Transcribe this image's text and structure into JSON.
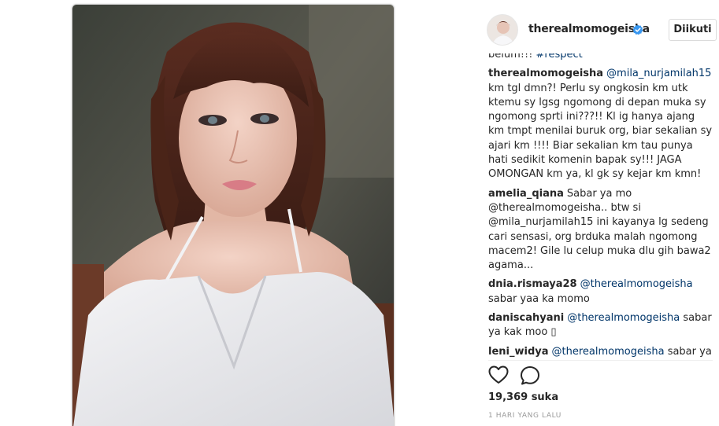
{
  "post": {
    "username": "therealmomogeisha",
    "follow_label": "Diikuti",
    "likes": "19,369 suka",
    "timestamp": "1 HARI YANG LALU"
  },
  "comments": [
    {
      "user": "",
      "mention": "",
      "text": "belum!!! ",
      "tag": "#respect"
    },
    {
      "user": "therealmomogeisha",
      "mention": "@mila_nurjamilah15",
      "text": " km tgl dmn?! Perlu sy ongkosin km utk ktemu sy lgsg ngomong di depan muka sy ngomong sprti ini???!! Kl ig hanya ajang km tmpt menilai buruk org, biar sekalian sy ajari km !!!! Biar sekalian km tau punya hati sedikit komenin bapak sy!!! JAGA OMONGAN km ya, kl gk sy kejar km kmn!",
      "tag": ""
    },
    {
      "user": "amelia_qiana",
      "mention": "",
      "text": "Sabar ya mo @therealmomogeisha.. btw si @mila_nurjamilah15 ini kayanya lg sedeng cari sensasi, org brduka malah ngomong macem2! Gile lu celup muka dlu gih bawa2 agama...",
      "tag": ""
    },
    {
      "user": "dnia.rismaya28",
      "mention": "@therealmomogeisha",
      "text": " sabar yaa ka momo",
      "tag": ""
    },
    {
      "user": "daniscahyani",
      "mention": "@therealmomogeisha",
      "text": " sabar ya kak moo ▯",
      "tag": ""
    },
    {
      "user": "leni_widya",
      "mention": "@therealmomogeisha",
      "text": " sabar ya",
      "tag": ""
    }
  ],
  "colors": {
    "link": "#003569",
    "verified": "#3897f0",
    "muted": "#999999",
    "text": "#262626"
  },
  "icons": [
    "verified-badge-icon",
    "heart-icon",
    "comment-icon"
  ]
}
